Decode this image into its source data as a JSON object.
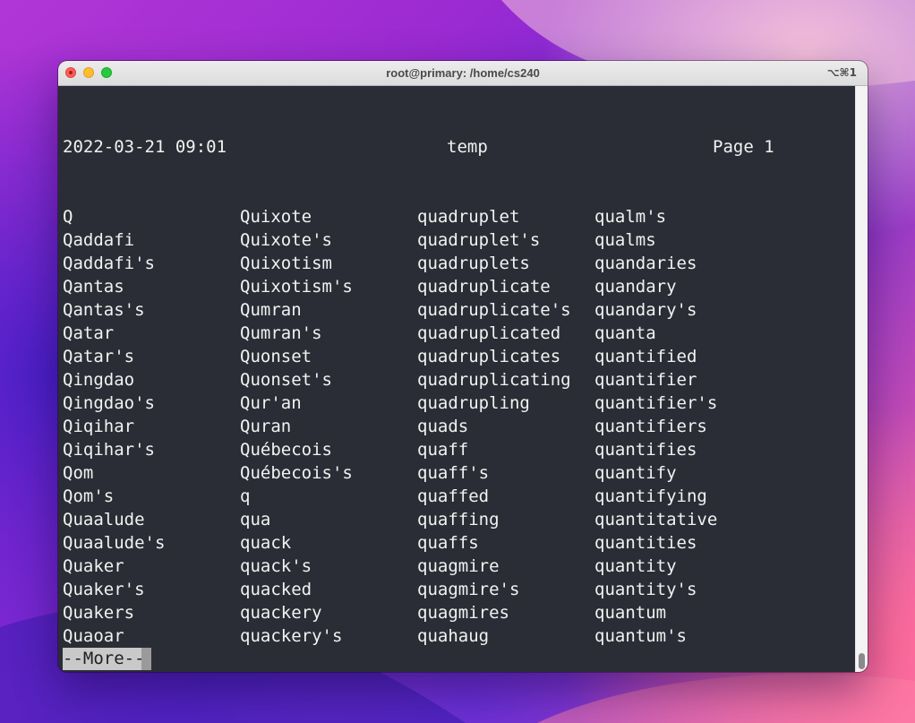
{
  "window": {
    "title": "root@primary: /home/cs240",
    "shortcut": "⌥⌘1"
  },
  "terminal": {
    "header": {
      "date": "2022-03-21 09:01",
      "file": "temp",
      "page": "Page 1"
    },
    "columns": [
      [
        "Q",
        "Qaddafi",
        "Qaddafi's",
        "Qantas",
        "Qantas's",
        "Qatar",
        "Qatar's",
        "Qingdao",
        "Qingdao's",
        "Qiqihar",
        "Qiqihar's",
        "Qom",
        "Qom's",
        "Quaalude",
        "Quaalude's",
        "Quaker",
        "Quaker's",
        "Quakers",
        "Quaoar"
      ],
      [
        "Quixote",
        "Quixote's",
        "Quixotism",
        "Quixotism's",
        "Qumran",
        "Qumran's",
        "Quonset",
        "Quonset's",
        "Qur'an",
        "Quran",
        "Québecois",
        "Québecois's",
        "q",
        "qua",
        "quack",
        "quack's",
        "quacked",
        "quackery",
        "quackery's"
      ],
      [
        "quadruplet",
        "quadruplet's",
        "quadruplets",
        "quadruplicate",
        "quadruplicate's",
        "quadruplicated",
        "quadruplicates",
        "quadruplicating",
        "quadrupling",
        "quads",
        "quaff",
        "quaff's",
        "quaffed",
        "quaffing",
        "quaffs",
        "quagmire",
        "quagmire's",
        "quagmires",
        "quahaug"
      ],
      [
        "qualm's",
        "qualms",
        "quandaries",
        "quandary",
        "quandary's",
        "quanta",
        "quantified",
        "quantifier",
        "quantifier's",
        "quantifiers",
        "quantifies",
        "quantify",
        "quantifying",
        "quantitative",
        "quantities",
        "quantity",
        "quantity's",
        "quantum",
        "quantum's"
      ]
    ],
    "pager_prompt": "--More--"
  },
  "colors": {
    "terminal_bg": "#2a2d35",
    "terminal_fg": "#f2f2f2",
    "prompt_bg": "#c9c9c9"
  }
}
